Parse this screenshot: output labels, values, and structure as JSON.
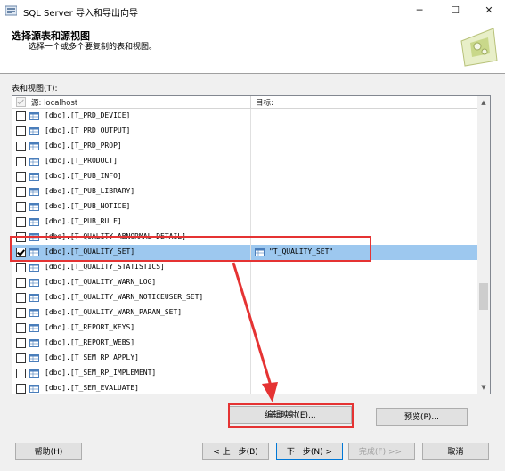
{
  "window": {
    "title": "SQL Server 导入和导出向导",
    "minimize": "─",
    "maximize": "☐",
    "close": "✕"
  },
  "header": {
    "title": "选择源表和源视图",
    "subtitle": "选择一个或多个要复制的表和视图。"
  },
  "list": {
    "label": "表和视图(T):",
    "col_source": "源: localhost",
    "col_target": "目标:",
    "rows": [
      {
        "source": "[dbo].[T_PRD_DEVICE]",
        "target": "",
        "checked": false,
        "selected": false
      },
      {
        "source": "[dbo].[T_PRD_OUTPUT]",
        "target": "",
        "checked": false,
        "selected": false
      },
      {
        "source": "[dbo].[T_PRD_PROP]",
        "target": "",
        "checked": false,
        "selected": false
      },
      {
        "source": "[dbo].[T_PRODUCT]",
        "target": "",
        "checked": false,
        "selected": false
      },
      {
        "source": "[dbo].[T_PUB_INFO]",
        "target": "",
        "checked": false,
        "selected": false
      },
      {
        "source": "[dbo].[T_PUB_LIBRARY]",
        "target": "",
        "checked": false,
        "selected": false
      },
      {
        "source": "[dbo].[T_PUB_NOTICE]",
        "target": "",
        "checked": false,
        "selected": false
      },
      {
        "source": "[dbo].[T_PUB_RULE]",
        "target": "",
        "checked": false,
        "selected": false
      },
      {
        "source": "[dbo].[T_QUALITY_ABNORMAL_DETAIL]",
        "target": "",
        "checked": false,
        "selected": false
      },
      {
        "source": "[dbo].[T_QUALITY_SET]",
        "target": "\"T_QUALITY_SET\"",
        "checked": true,
        "selected": true
      },
      {
        "source": "[dbo].[T_QUALITY_STATISTICS]",
        "target": "",
        "checked": false,
        "selected": false
      },
      {
        "source": "[dbo].[T_QUALITY_WARN_LOG]",
        "target": "",
        "checked": false,
        "selected": false
      },
      {
        "source": "[dbo].[T_QUALITY_WARN_NOTICEUSER_SET]",
        "target": "",
        "checked": false,
        "selected": false
      },
      {
        "source": "[dbo].[T_QUALITY_WARN_PARAM_SET]",
        "target": "",
        "checked": false,
        "selected": false
      },
      {
        "source": "[dbo].[T_REPORT_KEYS]",
        "target": "",
        "checked": false,
        "selected": false
      },
      {
        "source": "[dbo].[T_REPORT_WEBS]",
        "target": "",
        "checked": false,
        "selected": false
      },
      {
        "source": "[dbo].[T_SEM_RP_APPLY]",
        "target": "",
        "checked": false,
        "selected": false
      },
      {
        "source": "[dbo].[T_SEM_RP_IMPLEMENT]",
        "target": "",
        "checked": false,
        "selected": false
      },
      {
        "source": "[dbo].[T_SEM_EVALUATE]",
        "target": "",
        "checked": false,
        "selected": false
      }
    ]
  },
  "buttons": {
    "edit_mappings": "编辑映射(E)...",
    "preview": "预览(P)...",
    "help": "帮助(H)",
    "back": "< 上一步(B)",
    "next": "下一步(N) >",
    "finish": "完成(F) >>|",
    "cancel": "取消"
  },
  "colors": {
    "selection": "#9dc8ef",
    "annotation": "#e53333"
  },
  "icons": [
    "table-icon",
    "wizard-logo-icon",
    "scroll-up-icon",
    "scroll-down-icon"
  ]
}
